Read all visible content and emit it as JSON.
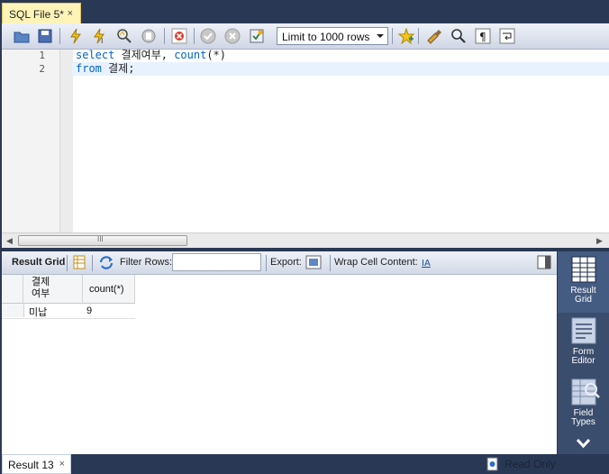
{
  "tab": {
    "title": "SQL File 5*",
    "close": "×"
  },
  "toolbar": {
    "limit_value": "Limit to 1000 rows",
    "icons": [
      "open-folder-icon",
      "save-icon",
      "execute-icon",
      "execute-current-icon",
      "explain-icon",
      "stop-icon",
      "toggle-error-icon",
      "commit-icon",
      "rollback-icon",
      "autocommit-icon",
      "bookmark-star-icon",
      "beautify-icon",
      "find-icon",
      "invisible-chars-icon",
      "wrap-icon"
    ]
  },
  "editor": {
    "lines": [
      {
        "no": "1",
        "parts": [
          {
            "t": "select",
            "kw": true
          },
          {
            "t": " 결제여부, ",
            "kw": false
          },
          {
            "t": "count",
            "kw": true
          },
          {
            "t": "(*)",
            "kw": false
          }
        ]
      },
      {
        "no": "2",
        "parts": [
          {
            "t": "from",
            "kw": true
          },
          {
            "t": " 결제;",
            "kw": false
          }
        ]
      }
    ]
  },
  "scroll": {
    "grip": "III"
  },
  "results_toolbar": {
    "result_grid": "Result Grid",
    "filter_rows": "Filter Rows:",
    "filter_value": "",
    "export": "Export:",
    "wrap_cell": "Wrap Cell Content:"
  },
  "grid": {
    "columns": [
      "결제\n여부",
      "count(*)"
    ],
    "rows": [
      [
        "미납",
        "9"
      ]
    ]
  },
  "side_panel": {
    "items": [
      {
        "label": "Result\nGrid",
        "active": true
      },
      {
        "label": "Form\nEditor",
        "active": false
      },
      {
        "label": "Field\nTypes",
        "active": false
      }
    ]
  },
  "status": {
    "result_tab": "Result 13",
    "close": "×",
    "read_only": "Read Only"
  },
  "colors": {
    "accent": "#293955",
    "tab_active": "#fff4b8",
    "keyword": "#0064c8",
    "side_active": "#445b82"
  }
}
